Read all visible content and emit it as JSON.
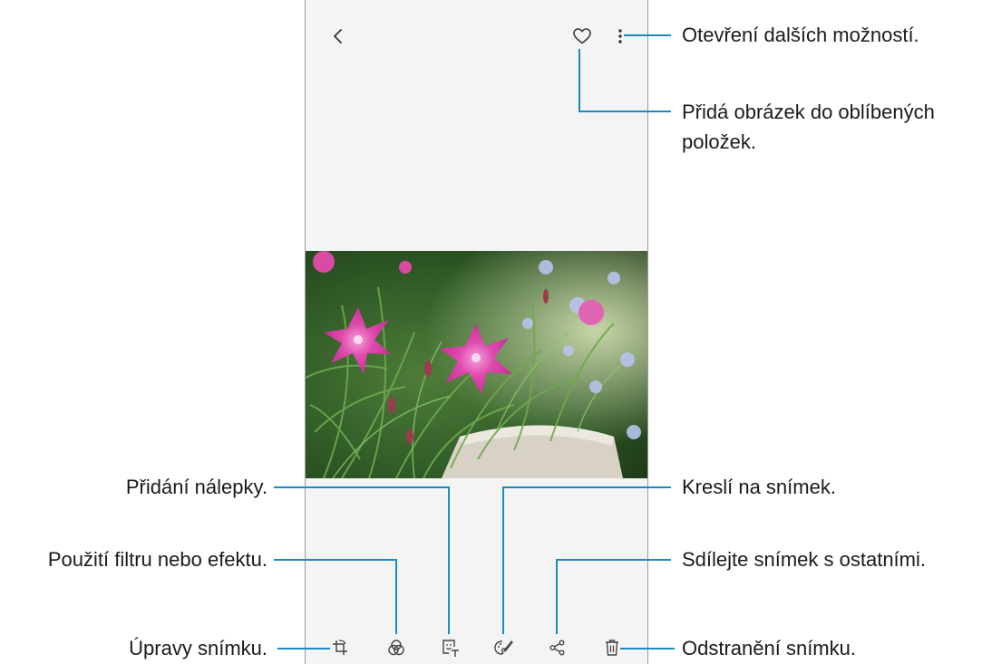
{
  "toolbar_top": {
    "back_icon": "chevron-left-icon",
    "favorite_icon": "heart-icon",
    "more_icon": "more-vertical-icon"
  },
  "toolbar_bottom": {
    "icons": [
      "crop-rotate-icon",
      "filter-icon",
      "sticker-icon",
      "draw-icon",
      "share-icon",
      "trash-icon"
    ]
  },
  "annotations": {
    "more_options": "Otevření dalších možností.",
    "favorite_line1": "Přidá obrázek do oblíbených",
    "favorite_line2": "položek.",
    "sticker": "Přidání nálepky.",
    "draw": "Kreslí na snímek.",
    "filter": "Použití filtru nebo efektu.",
    "share": "Sdílejte snímek s ostatními.",
    "edit": "Úpravy snímku.",
    "delete": "Odstranění snímku."
  },
  "colors": {
    "accent_line": "#1a8bbf",
    "screen_bg": "#f3f4f3",
    "icon": "#444444"
  }
}
